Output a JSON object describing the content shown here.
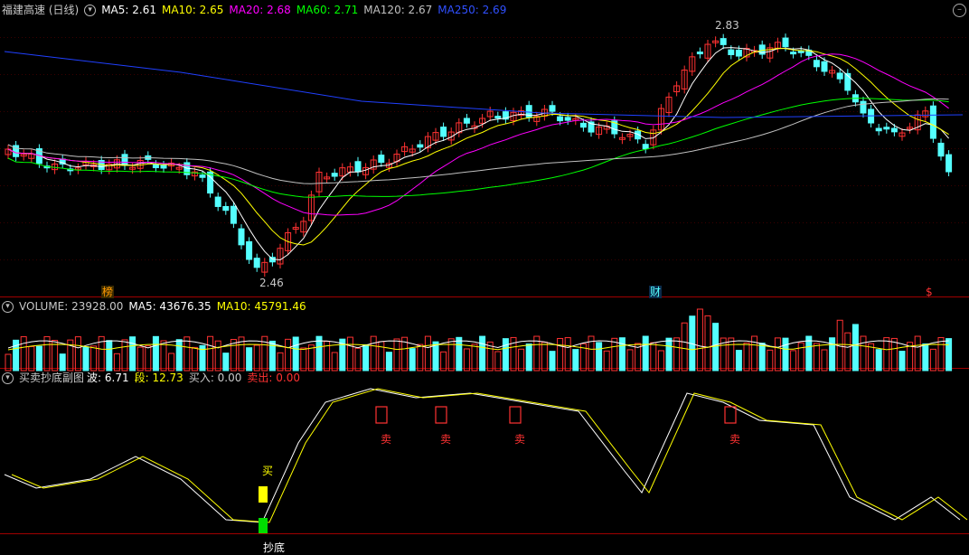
{
  "colors": {
    "bg": "#000000",
    "up": "#ff3232",
    "down": "#54ffff",
    "grid": "#7a0000",
    "ma5": "#ffffff",
    "ma10": "#ffff00",
    "ma20": "#ff00ff",
    "ma60": "#00ff00",
    "ma120": "#c0c0c0",
    "ma250": "#2040ff"
  },
  "price_panel": {
    "title": "福建高速 (日线)",
    "legend": [
      {
        "key": "ma5",
        "label": "MA5: 2.61",
        "color": "#ffffff"
      },
      {
        "key": "ma10",
        "label": "MA10: 2.65",
        "color": "#ffff00"
      },
      {
        "key": "ma20",
        "label": "MA20: 2.68",
        "color": "#ff00ff"
      },
      {
        "key": "ma60",
        "label": "MA60: 2.71",
        "color": "#00ff00"
      },
      {
        "key": "ma120",
        "label": "MA120: 2.67",
        "color": "#c0c0c0"
      },
      {
        "key": "ma250",
        "label": "MA250: 2.69",
        "color": "#2040ff"
      }
    ],
    "high_label": "2.83",
    "low_label": "2.46",
    "markers": [
      {
        "text": "榜",
        "color": "#ff9900"
      },
      {
        "text": "财",
        "color": "#54ffff"
      },
      {
        "text": "$",
        "color": "#ff3232"
      }
    ]
  },
  "volume_panel": {
    "label": "VOLUME: 23928.00",
    "ma5": "MA5: 43676.35",
    "ma10": "MA10: 45791.46"
  },
  "indicator_panel": {
    "name": "买卖抄底副图",
    "bo": "波: 6.71",
    "duan": "段: 12.73",
    "buy": "买入: 0.00",
    "sell": "卖出: 0.00",
    "buy_tag": "买",
    "bottom_tag": "抄底",
    "sell_tag": "卖"
  }
}
